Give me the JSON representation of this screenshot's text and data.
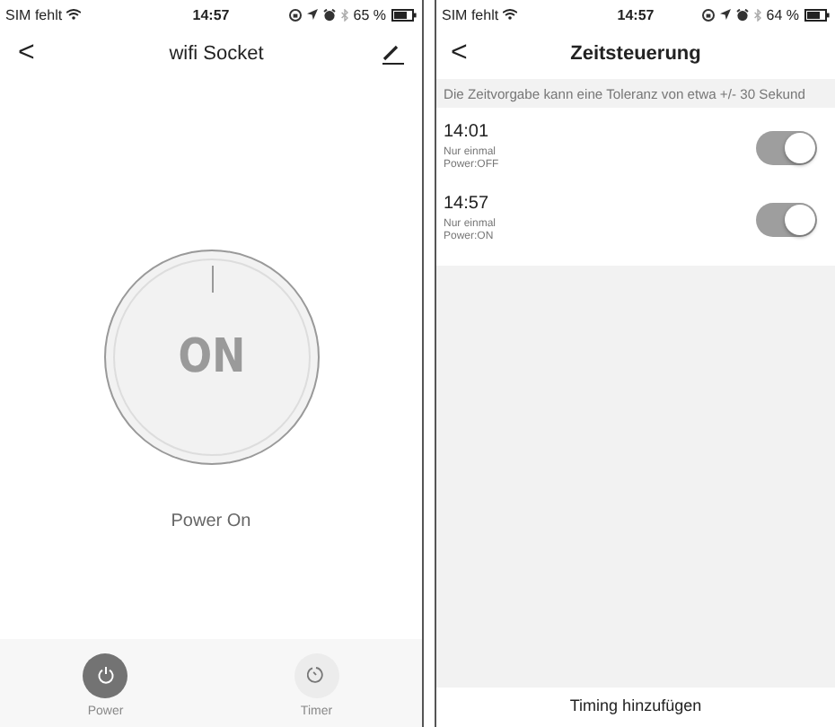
{
  "device_screen": {
    "status_bar": {
      "carrier": "SIM fehlt",
      "time": "14:57",
      "battery": "65 %"
    },
    "nav": {
      "back": "<",
      "title": "wifi Socket"
    },
    "dial": {
      "label": "ON",
      "on": true
    },
    "status_text": "Power On",
    "tabs": [
      {
        "kind": "power",
        "label": "Power",
        "selected": true
      },
      {
        "kind": "timer",
        "label": "Timer",
        "selected": false
      }
    ]
  },
  "timer_screen": {
    "status_bar": {
      "carrier": "SIM fehlt",
      "time": "14:57",
      "battery": "64 %"
    },
    "nav": {
      "back": "<",
      "title": "Zeitsteuerung"
    },
    "notice": "Die Zeitvorgabe kann eine Toleranz von etwa +/- 30 Sekund",
    "timers": [
      {
        "time": "14:01",
        "repeat": "Nur einmal",
        "action": "Power:OFF",
        "on": true
      },
      {
        "time": "14:57",
        "repeat": "Nur einmal",
        "action": "Power:ON",
        "on": true
      }
    ],
    "add_button": "Timing hinzufügen"
  }
}
